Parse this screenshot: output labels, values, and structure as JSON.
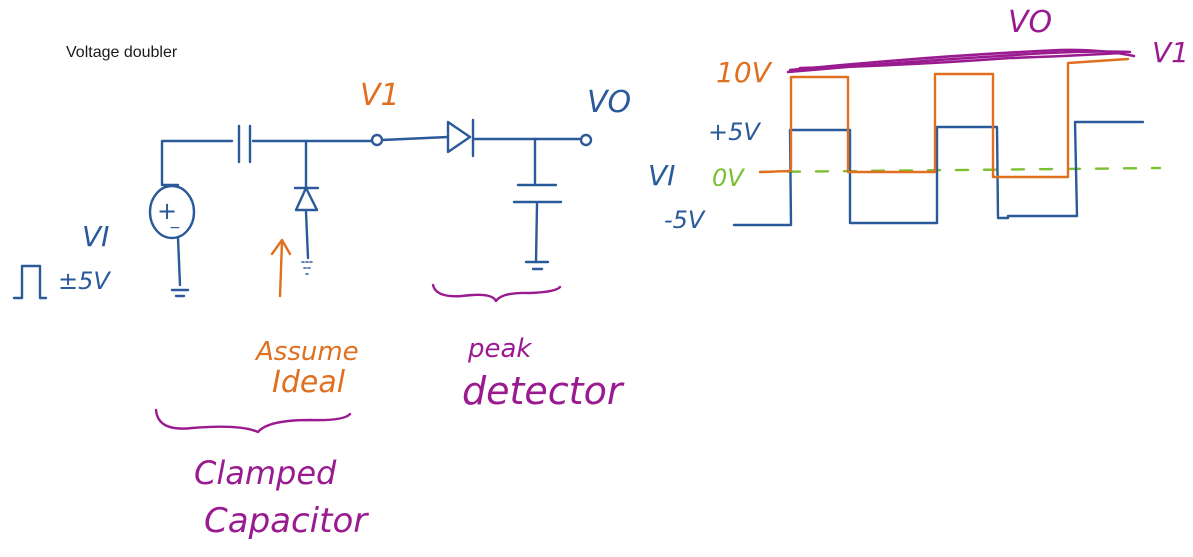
{
  "page_title": "Voltage doubler",
  "colors": {
    "circuit_ink": "#2a5a9a",
    "signal_ink": "#e07020",
    "annotation_ink": "#9a1a90",
    "ground_ref_ink": "#7ac030"
  },
  "circuit": {
    "source_label": "VI",
    "source_symbol": "+",
    "source_polarity_minus": "−",
    "source_amplitude": "±5V",
    "node_v1_label": "V1",
    "output_label": "VO",
    "assume_ideal_label_line1": "Assume",
    "assume_ideal_label_line2": "Ideal",
    "peak_detector_line1": "peak",
    "peak_detector_line2": "detector",
    "clamped_capacitor_line1": "Clamped",
    "clamped_capacitor_line2": "Capacitor"
  },
  "waveform": {
    "vo_label": "VO",
    "v1_label": "V1",
    "vi_label": "VI",
    "level_10v": "10V",
    "level_p5v": "+5V",
    "level_0v": "0V",
    "level_m5v": "-5V"
  }
}
